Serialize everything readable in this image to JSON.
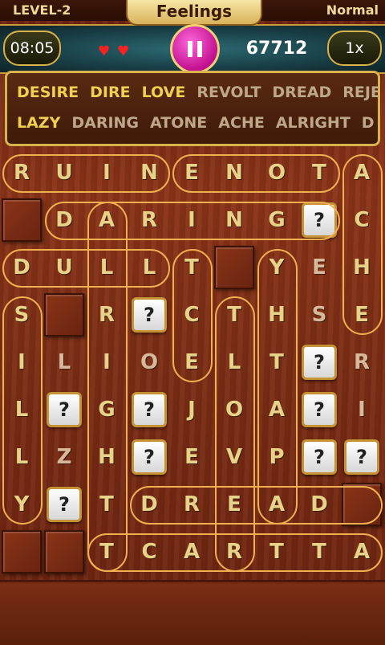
{
  "header": {
    "level": "LEVEL-2",
    "title": "Feelings",
    "mode": "Normal"
  },
  "hud": {
    "timer": "08:05",
    "lives": 2,
    "score": "67712",
    "multiplier": "1x"
  },
  "words": {
    "row1": [
      {
        "text": "DESIRE",
        "found": true
      },
      {
        "text": "DIRE",
        "found": true
      },
      {
        "text": "LOVE",
        "found": true
      },
      {
        "text": "REVOLT",
        "found": false
      },
      {
        "text": "DREAD",
        "found": false
      },
      {
        "text": "REJE",
        "found": false
      }
    ],
    "row2": [
      {
        "text": "LAZY",
        "found": true
      },
      {
        "text": "DARING",
        "found": false
      },
      {
        "text": "ATONE",
        "found": false
      },
      {
        "text": "ACHE",
        "found": false
      },
      {
        "text": "ALRIGHT",
        "found": false
      },
      {
        "text": "D",
        "found": false
      }
    ]
  },
  "grid": [
    [
      "R",
      "U",
      "I",
      "N",
      "E",
      "N",
      "O",
      "T",
      "A"
    ],
    [
      "#",
      "D",
      "A",
      "R",
      "I",
      "N",
      "G",
      "?",
      "C"
    ],
    [
      "D",
      "U",
      "L",
      "L",
      "T",
      "#",
      "Y",
      "E",
      "H"
    ],
    [
      "S",
      "#",
      "R",
      "?",
      "C",
      "T",
      "H",
      "S",
      "E"
    ],
    [
      "I",
      "L",
      "I",
      "O",
      "E",
      "L",
      "T",
      "?",
      "R"
    ],
    [
      "L",
      "?",
      "G",
      "?",
      "J",
      "O",
      "A",
      "?",
      "I"
    ],
    [
      "L",
      "Z",
      "H",
      "?",
      "E",
      "V",
      "P",
      "?",
      "?"
    ],
    [
      "Y",
      "?",
      "T",
      "D",
      "R",
      "E",
      "A",
      "D",
      "#"
    ],
    [
      "#",
      "#",
      "T",
      "C",
      "A",
      "R",
      "T",
      "T",
      "A"
    ]
  ],
  "dim_letters": [
    "4,1",
    "4,3",
    "3,7",
    "2,7",
    "4,8",
    "5,8",
    "6,1"
  ]
}
